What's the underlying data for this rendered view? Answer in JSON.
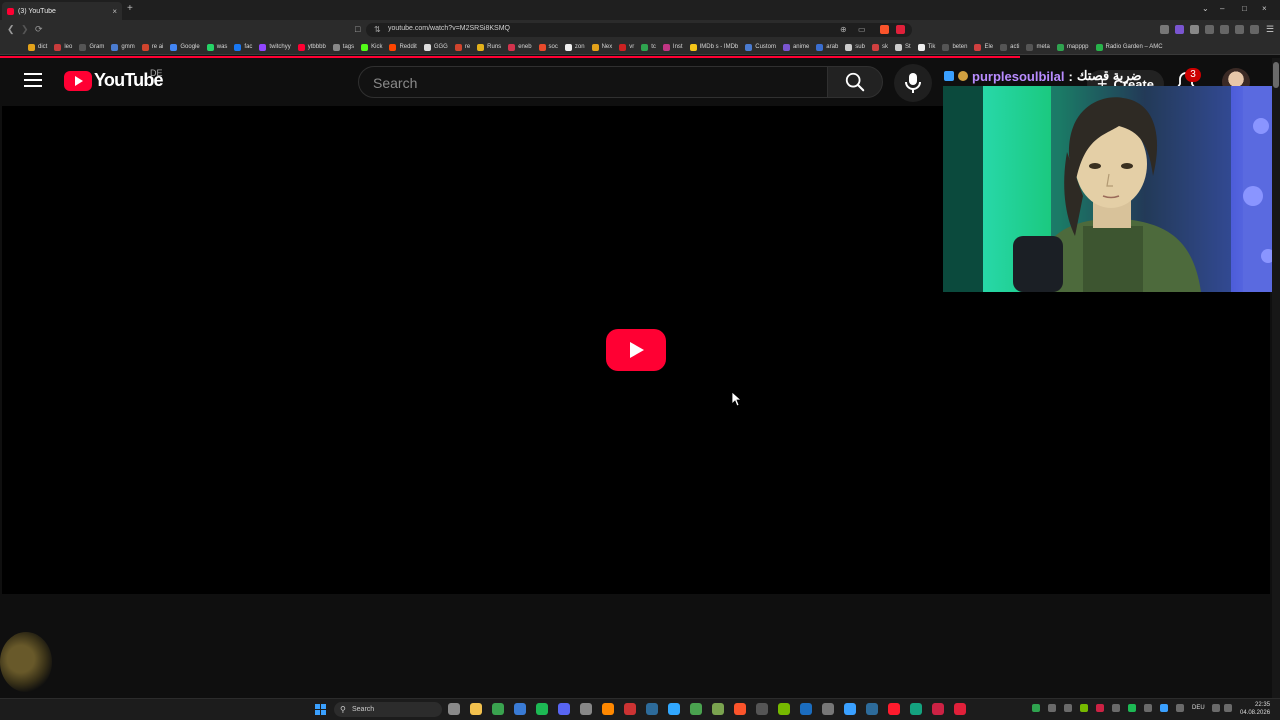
{
  "browser": {
    "tab": {
      "title": "(3) YouTube",
      "close": "×"
    },
    "new_tab": "+",
    "window_controls": {
      "chevron": "⌄",
      "minimize": "–",
      "maximize": "□",
      "close": "×"
    },
    "url": "youtube.com/watch?v=M2SRSi8KSMQ",
    "bookmarks": [
      {
        "label": "dict",
        "color": "#e3a21a"
      },
      {
        "label": "leo",
        "color": "#c83c3c"
      },
      {
        "label": "Gram",
        "color": "#555555"
      },
      {
        "label": "gmm",
        "color": "#4a7bd0"
      },
      {
        "label": "re ai",
        "color": "#d0442d"
      },
      {
        "label": "Google",
        "color": "#4285f4"
      },
      {
        "label": "was",
        "color": "#25d366"
      },
      {
        "label": "fac",
        "color": "#1877f2"
      },
      {
        "label": "twitchyy",
        "color": "#9146ff"
      },
      {
        "label": "ytbbbb",
        "color": "#ff0033"
      },
      {
        "label": "tags",
        "color": "#888888"
      },
      {
        "label": "Kick",
        "color": "#53fc18"
      },
      {
        "label": "Reddit",
        "color": "#ff4500"
      },
      {
        "label": "GGG",
        "color": "#dddddd"
      },
      {
        "label": "re",
        "color": "#d0442d"
      },
      {
        "label": "Runs",
        "color": "#e3b11a"
      },
      {
        "label": "eneb",
        "color": "#d3334d"
      },
      {
        "label": "soc",
        "color": "#e84a2b"
      },
      {
        "label": "zon",
        "color": "#eeeeee"
      },
      {
        "label": "Nex",
        "color": "#e3a21a"
      },
      {
        "label": "vr",
        "color": "#cc2222"
      },
      {
        "label": "tc",
        "color": "#2fa34f"
      },
      {
        "label": "Inst",
        "color": "#c13584"
      },
      {
        "label": "IMDb s - IMDb",
        "color": "#f5c518"
      },
      {
        "label": "Custom",
        "color": "#4a7bd0"
      },
      {
        "label": "anime",
        "color": "#7a55d0"
      },
      {
        "label": "arab",
        "color": "#3a6ed0"
      },
      {
        "label": "sub",
        "color": "#cccccc"
      },
      {
        "label": "sk",
        "color": "#d04040"
      },
      {
        "label": "St",
        "color": "#cccccc"
      },
      {
        "label": "Tik",
        "color": "#eeeeee"
      },
      {
        "label": "beten",
        "color": "#555555"
      },
      {
        "label": "Ele",
        "color": "#d04040"
      },
      {
        "label": "acti",
        "color": "#555555"
      },
      {
        "label": "meta",
        "color": "#555555"
      },
      {
        "label": "mapppp",
        "color": "#2fa34f"
      },
      {
        "label": "Radio Garden – AMC",
        "color": "#27b34a"
      }
    ]
  },
  "youtube": {
    "wordmark": "YouTube",
    "country": "DE",
    "search_placeholder": "Search",
    "create_label": "Create",
    "notification_count": "3"
  },
  "overlay": {
    "username": "purplesoulbilal",
    "separator": ":",
    "message": "ضربة قصتك"
  },
  "taskbar": {
    "search_label": "Search",
    "language": "DEU",
    "time": "22:35",
    "date": "04.08.2026",
    "apps": [
      {
        "name": "settings",
        "color": "#8a8a8a"
      },
      {
        "name": "file-explorer",
        "color": "#f2c14e"
      },
      {
        "name": "xbox",
        "color": "#3aa34f"
      },
      {
        "name": "photos",
        "color": "#3a7bd5"
      },
      {
        "name": "spotify",
        "color": "#1db954"
      },
      {
        "name": "discord",
        "color": "#5865f2"
      },
      {
        "name": "media",
        "color": "#888888"
      },
      {
        "name": "vlc",
        "color": "#ff8800"
      },
      {
        "name": "app",
        "color": "#cc3333"
      },
      {
        "name": "terminal",
        "color": "#2d6b9a"
      },
      {
        "name": "photoshop",
        "color": "#31a8ff"
      },
      {
        "name": "app2",
        "color": "#4aa34f"
      },
      {
        "name": "app3",
        "color": "#7aa34f"
      },
      {
        "name": "brave",
        "color": "#fb542b"
      },
      {
        "name": "app4",
        "color": "#555555"
      },
      {
        "name": "nvidia",
        "color": "#76b900"
      },
      {
        "name": "steam",
        "color": "#1b6dbf"
      },
      {
        "name": "app5",
        "color": "#777777"
      },
      {
        "name": "app6",
        "color": "#3aa0ff"
      },
      {
        "name": "app7",
        "color": "#2d6b9a"
      },
      {
        "name": "opera",
        "color": "#ff1b2d"
      },
      {
        "name": "app8",
        "color": "#14a37f"
      },
      {
        "name": "app9",
        "color": "#cc2244"
      },
      {
        "name": "app10",
        "color": "#e0203a"
      }
    ]
  }
}
